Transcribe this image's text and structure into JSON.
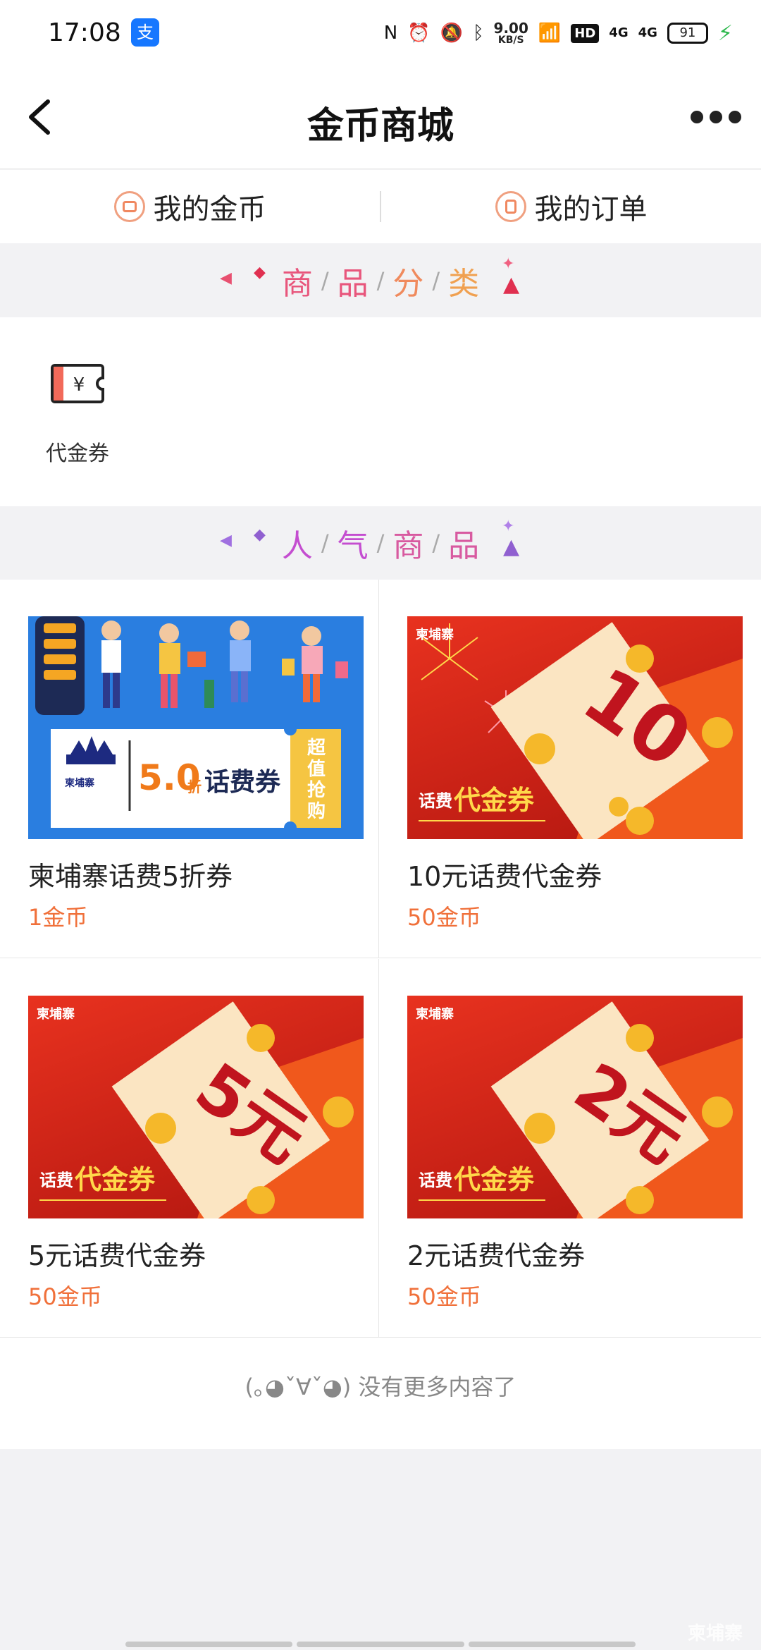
{
  "status_bar": {
    "time": "17:08",
    "app_badge": "支",
    "net_speed_value": "9.00",
    "net_speed_unit": "KB/S",
    "hd_label": "HD",
    "signal1_label": "4G",
    "signal2_label": "4G",
    "battery": "91"
  },
  "header": {
    "title": "金币商城"
  },
  "subnav": {
    "my_coins": "我的金币",
    "my_orders": "我的订单"
  },
  "section_category": {
    "chars": [
      "商",
      "品",
      "分",
      "类"
    ],
    "separator": "/"
  },
  "categories": [
    {
      "label": "代金券",
      "icon": "voucher-icon"
    }
  ],
  "section_popular": {
    "chars": [
      "人",
      "气",
      "商",
      "品"
    ],
    "separator": "/"
  },
  "products": [
    {
      "name": "柬埔寨话费5折券",
      "price": "1金币",
      "banner": {
        "brand": "柬埔寨",
        "discount_num": "5.0",
        "discount_unit": "折",
        "coupon_text": "话费券",
        "side_text": "超值抢购"
      }
    },
    {
      "name": "10元话费代金券",
      "price": "50金币",
      "banner": {
        "brand": "柬埔寨",
        "amount": "10",
        "label_small": "话费",
        "label_big": "代金券"
      }
    },
    {
      "name": "5元话费代金券",
      "price": "50金币",
      "banner": {
        "brand": "柬埔寨",
        "amount": "5元",
        "label_small": "话费",
        "label_big": "代金券"
      }
    },
    {
      "name": "2元话费代金券",
      "price": "50金币",
      "banner": {
        "brand": "柬埔寨",
        "amount": "2元",
        "label_small": "话费",
        "label_big": "代金券"
      }
    }
  ],
  "footer": {
    "end_text": "(｡◕ˇ∀ˇ◕) 没有更多内容了"
  },
  "watermark": "柬埔寨",
  "colors": {
    "price": "#f0703a",
    "banner_red": "#d8281c",
    "banner_blue": "#2a7ee0",
    "accent_yellow": "#ffd84a"
  }
}
